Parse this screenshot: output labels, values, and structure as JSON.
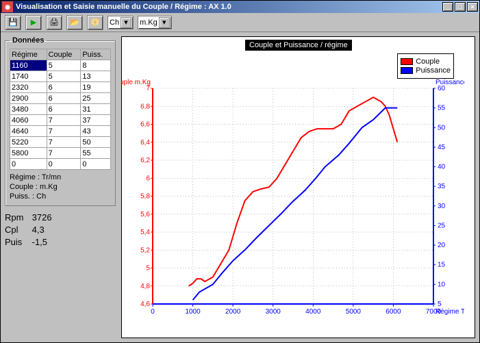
{
  "window": {
    "title": "Visualisation et Saisie manuelle du Couple / Régime : AX 1.0"
  },
  "toolbar": {
    "save_icon": "💾",
    "play_icon": "▶",
    "print_icon": "🖨",
    "load_icon": "📂",
    "savewide_icon": "📀",
    "dd1_value": "Ch",
    "dd2_value": "m.Kg"
  },
  "data_group": {
    "legend": "Données",
    "cols": [
      "Régime",
      "Couple",
      "Puiss."
    ],
    "rows": [
      [
        "1160",
        "5",
        "8"
      ],
      [
        "1740",
        "5",
        "13"
      ],
      [
        "2320",
        "6",
        "19"
      ],
      [
        "2900",
        "6",
        "25"
      ],
      [
        "3480",
        "6",
        "31"
      ],
      [
        "4060",
        "7",
        "37"
      ],
      [
        "4640",
        "7",
        "43"
      ],
      [
        "5220",
        "7",
        "50"
      ],
      [
        "5800",
        "7",
        "55"
      ],
      [
        "0",
        "0",
        "0"
      ]
    ],
    "units": [
      [
        "Régime :",
        "Tr/mn"
      ],
      [
        "Couple :",
        "m.Kg"
      ],
      [
        "Puiss. :",
        "Ch"
      ]
    ]
  },
  "readout": {
    "rpm_label": "Rpm",
    "rpm": "3726",
    "cpl_label": "Cpl",
    "cpl": "4,3",
    "puis_label": "Puis",
    "puis": "-1,5"
  },
  "chart": {
    "title": "Couple et Puissance / régime",
    "legend": [
      {
        "label": "Couple",
        "color": "#ff0000"
      },
      {
        "label": "Puissance",
        "color": "#0000ff"
      }
    ],
    "ylabel_left": "Couple m.Kg",
    "ylabel_right": "Puissance Ch",
    "xlabel": "Régime Tr/mn",
    "xticks": [
      0,
      1000,
      2000,
      3000,
      4000,
      5000,
      6000,
      7000
    ],
    "yticks_left": [
      4.6,
      4.8,
      5,
      5.2,
      5.4,
      5.6,
      5.8,
      6,
      6.2,
      6.4,
      6.6,
      6.8,
      7
    ],
    "yticks_right": [
      5,
      10,
      15,
      20,
      25,
      30,
      35,
      40,
      45,
      50,
      55,
      60
    ]
  },
  "chart_data": {
    "type": "line",
    "x_shared": false,
    "xlabel": "Régime Tr/mn",
    "series": [
      {
        "name": "Couple",
        "axis": "left",
        "ylabel": "Couple m.Kg",
        "ylim": [
          4.6,
          7
        ],
        "color": "#ff0000",
        "x": [
          900,
          1000,
          1100,
          1200,
          1300,
          1500,
          1700,
          1900,
          2100,
          2300,
          2500,
          2700,
          2900,
          3100,
          3300,
          3500,
          3700,
          3900,
          4100,
          4300,
          4500,
          4700,
          4900,
          5100,
          5300,
          5500,
          5700,
          5800,
          5900,
          6000,
          6100
        ],
        "y": [
          4.8,
          4.83,
          4.88,
          4.88,
          4.85,
          4.9,
          5.05,
          5.2,
          5.5,
          5.75,
          5.85,
          5.88,
          5.9,
          6.0,
          6.15,
          6.3,
          6.45,
          6.52,
          6.55,
          6.55,
          6.55,
          6.6,
          6.75,
          6.8,
          6.85,
          6.9,
          6.85,
          6.8,
          6.7,
          6.55,
          6.4
        ]
      },
      {
        "name": "Puissance",
        "axis": "right",
        "ylabel": "Puissance Ch",
        "ylim": [
          5,
          60
        ],
        "color": "#0000ff",
        "x": [
          1000,
          1160,
          1500,
          1740,
          2000,
          2320,
          2600,
          2900,
          3200,
          3480,
          3800,
          4060,
          4300,
          4640,
          4900,
          5220,
          5500,
          5800,
          6000,
          6100
        ],
        "y": [
          6,
          8,
          10,
          13,
          16,
          19,
          22,
          25,
          28,
          31,
          34,
          37,
          40,
          43,
          46,
          50,
          52,
          55,
          55,
          55
        ]
      }
    ],
    "xlim": [
      0,
      7000
    ],
    "title": "Couple et Puissance / régime"
  }
}
